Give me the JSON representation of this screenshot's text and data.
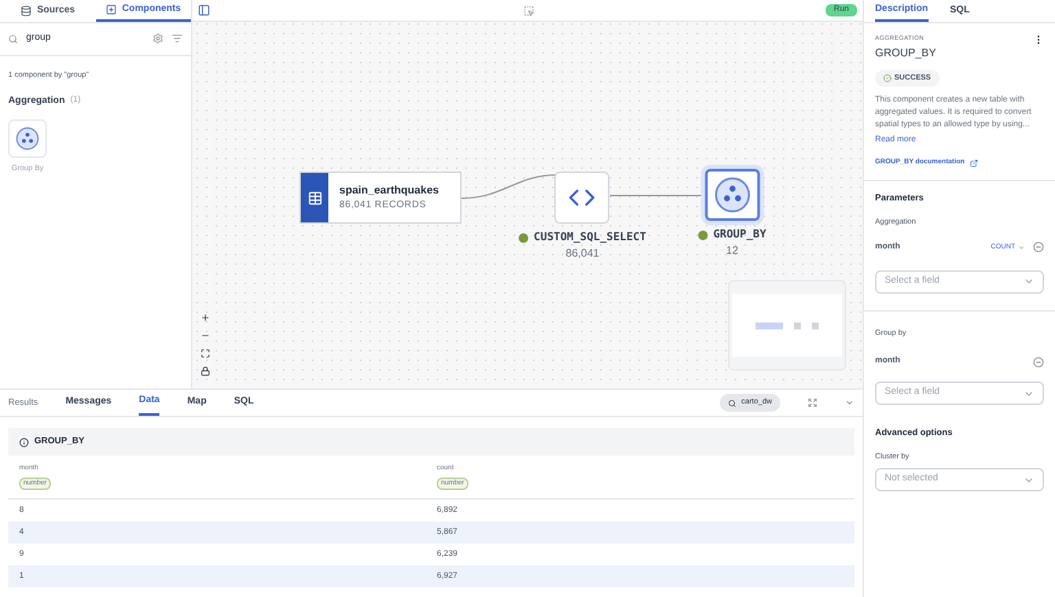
{
  "sidebar": {
    "tabs": [
      {
        "label": "Sources",
        "selected": false
      },
      {
        "label": "Components",
        "selected": true
      }
    ],
    "search": {
      "value": "group"
    },
    "result_count": "1 component by \"group\"",
    "groups": [
      {
        "title": "Aggregation",
        "count": "(1)",
        "items": [
          {
            "label": "Group By"
          }
        ]
      }
    ]
  },
  "toolbar": {
    "run_button": "Run"
  },
  "canvas": {
    "nodes": [
      {
        "kind": "source",
        "title": "spain_earthquakes",
        "subtitle": "86,041 RECORDS"
      },
      {
        "kind": "sql",
        "title": "CUSTOM_SQL_SELECT",
        "subtitle": "86,041",
        "color": "#7c9a3c",
        "selected": false
      },
      {
        "kind": "group",
        "title": "GROUP_BY",
        "subtitle": "12",
        "color": "#7c9a3c",
        "selected": true
      }
    ]
  },
  "results": {
    "tabs": [
      {
        "label": "Results",
        "kind": "label",
        "selected": false
      },
      {
        "label": "Messages",
        "kind": "tab",
        "selected": false
      },
      {
        "label": "Data",
        "kind": "tab",
        "selected": true
      },
      {
        "label": "Map",
        "kind": "tab",
        "selected": false
      },
      {
        "label": "SQL",
        "kind": "tab",
        "selected": false
      }
    ],
    "connection": "carto_dw",
    "table_title": "GROUP_BY",
    "columns": [
      {
        "name": "month",
        "type": "number"
      },
      {
        "name": "count",
        "type": "number"
      }
    ],
    "rows": [
      [
        "8",
        "6,892"
      ],
      [
        "4",
        "5,867"
      ],
      [
        "9",
        "6,239"
      ],
      [
        "1",
        "6,927"
      ]
    ]
  },
  "panel": {
    "tabs": [
      {
        "label": "Description",
        "selected": true
      },
      {
        "label": "SQL",
        "selected": false
      }
    ],
    "category": "AGGREGATION",
    "title": "GROUP_BY",
    "status": "SUCCESS",
    "description": "This component creates a new table with aggregated values. It is required to convert spatial types to an allowed type by using...",
    "read_more": "Read more",
    "doc_link": "GROUP_BY documentation",
    "parameters_title": "Parameters",
    "aggregation": {
      "label": "Aggregation",
      "field": "month",
      "operation": "COUNT",
      "placeholder": "Select a field"
    },
    "group_by": {
      "label": "Group by",
      "field": "month",
      "placeholder": "Select a field"
    },
    "advanced_title": "Advanced options",
    "cluster": {
      "label": "Cluster by",
      "placeholder": "Not selected"
    }
  }
}
